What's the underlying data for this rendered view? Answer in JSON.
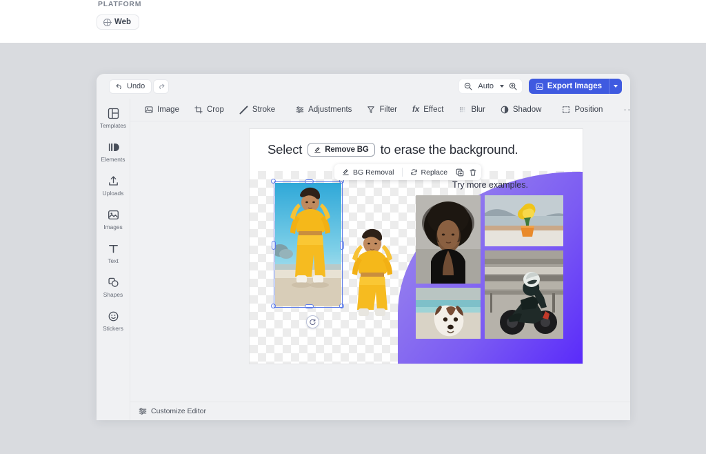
{
  "platform": {
    "section_label": "PLATFORM",
    "chip_label": "Web",
    "chip_icon": "globe-icon"
  },
  "topbar": {
    "undo_label": "Undo",
    "undo_icon": "undo-arrow-icon",
    "redo_icon": "redo-arrow-icon",
    "zoom_out_icon": "zoom-out-icon",
    "zoom_value": "Auto",
    "zoom_dropdown_icon": "chevron-down-icon",
    "zoom_in_icon": "zoom-in-icon",
    "export_label": "Export Images",
    "export_icon": "image-icon",
    "export_dropdown_icon": "chevron-down-icon",
    "accent_color": "#3f5ae0"
  },
  "toolbar": {
    "items": [
      {
        "label": "Image",
        "icon": "image-icon"
      },
      {
        "label": "Crop",
        "icon": "crop-icon"
      },
      {
        "label": "Stroke",
        "icon": "stroke-line-icon"
      },
      {
        "label": "Adjustments",
        "icon": "sliders-icon"
      },
      {
        "label": "Filter",
        "icon": "filter-funnel-icon"
      },
      {
        "label": "Effect",
        "icon": "fx-icon"
      },
      {
        "label": "Blur",
        "icon": "blur-dots-icon"
      },
      {
        "label": "Shadow",
        "icon": "shadow-circle-icon"
      }
    ],
    "position_label": "Position",
    "position_icon": "position-frame-icon",
    "more_label": "···",
    "more_icon": "more-horizontal-icon"
  },
  "sidebar": {
    "items": [
      {
        "label": "Templates",
        "icon": "templates-grid-icon"
      },
      {
        "label": "Elements",
        "icon": "elements-bars-icon"
      },
      {
        "label": "Uploads",
        "icon": "upload-arrow-icon"
      },
      {
        "label": "Images",
        "icon": "picture-icon"
      },
      {
        "label": "Text",
        "icon": "text-t-icon"
      },
      {
        "label": "Shapes",
        "icon": "shapes-icon"
      },
      {
        "label": "Stickers",
        "icon": "sticker-smiley-icon"
      }
    ]
  },
  "context_toolbar": {
    "bg_removal_label": "BG Removal",
    "bg_removal_icon": "bg-removal-icon",
    "replace_label": "Replace",
    "replace_icon": "replace-refresh-icon",
    "duplicate_icon": "duplicate-icon",
    "delete_icon": "trash-icon"
  },
  "canvas": {
    "headline_prefix": "Select",
    "headline_chip": "Remove BG",
    "headline_chip_icon": "bg-removal-icon",
    "headline_suffix": "to erase the background.",
    "examples_title": "Try more examples.",
    "purple_gradient_from": "#a08cf0",
    "purple_gradient_to": "#5a2bfa",
    "thumbnails": [
      {
        "name": "portrait-afro-woman"
      },
      {
        "name": "flower-pot-balcony"
      },
      {
        "name": "dog-at-beach"
      },
      {
        "name": "motorcycle-rider"
      }
    ],
    "selected_object": {
      "name": "yellow-outfit-dancer-photo",
      "rotate_handle_icon": "rotate-icon"
    }
  },
  "statusbar": {
    "customize_label": "Customize Editor",
    "customize_icon": "sliders-icon"
  }
}
